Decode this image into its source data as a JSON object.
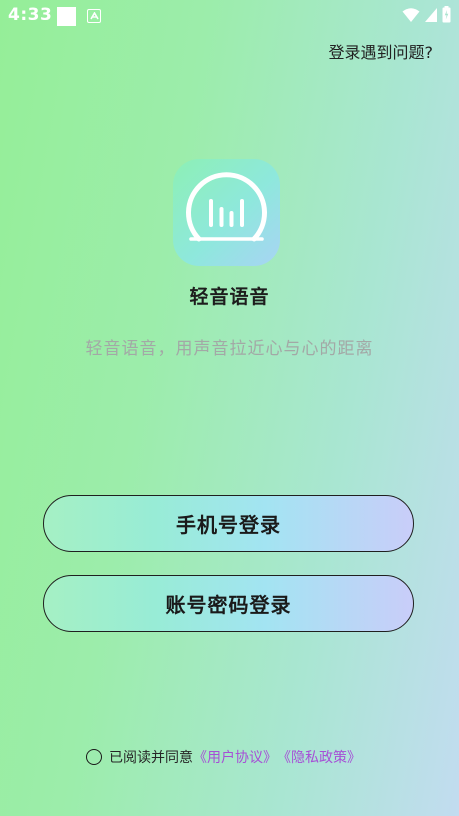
{
  "status_bar": {
    "time": "4:33",
    "icons": [
      "notification-square-icon",
      "android-icon",
      "wifi-icon",
      "signal-icon",
      "battery-icon"
    ]
  },
  "header": {
    "help_link": "登录遇到问题?"
  },
  "app": {
    "logo_icon": "sound-wave-logo-icon",
    "name": "轻音语音",
    "slogan": "轻音语音，用声音拉近心与心的距离"
  },
  "actions": {
    "phone_login": "手机号登录",
    "account_login": "账号密码登录"
  },
  "agreement": {
    "checked": false,
    "prefix": "已阅读并同意",
    "user_agreement": "《用户协议》",
    "privacy_policy": "《隐私政策》"
  },
  "colors": {
    "background_start": "#95ee98",
    "background_end": "#c2dcf0",
    "link": "#a64fd6",
    "slogan": "#a3a8a6"
  }
}
